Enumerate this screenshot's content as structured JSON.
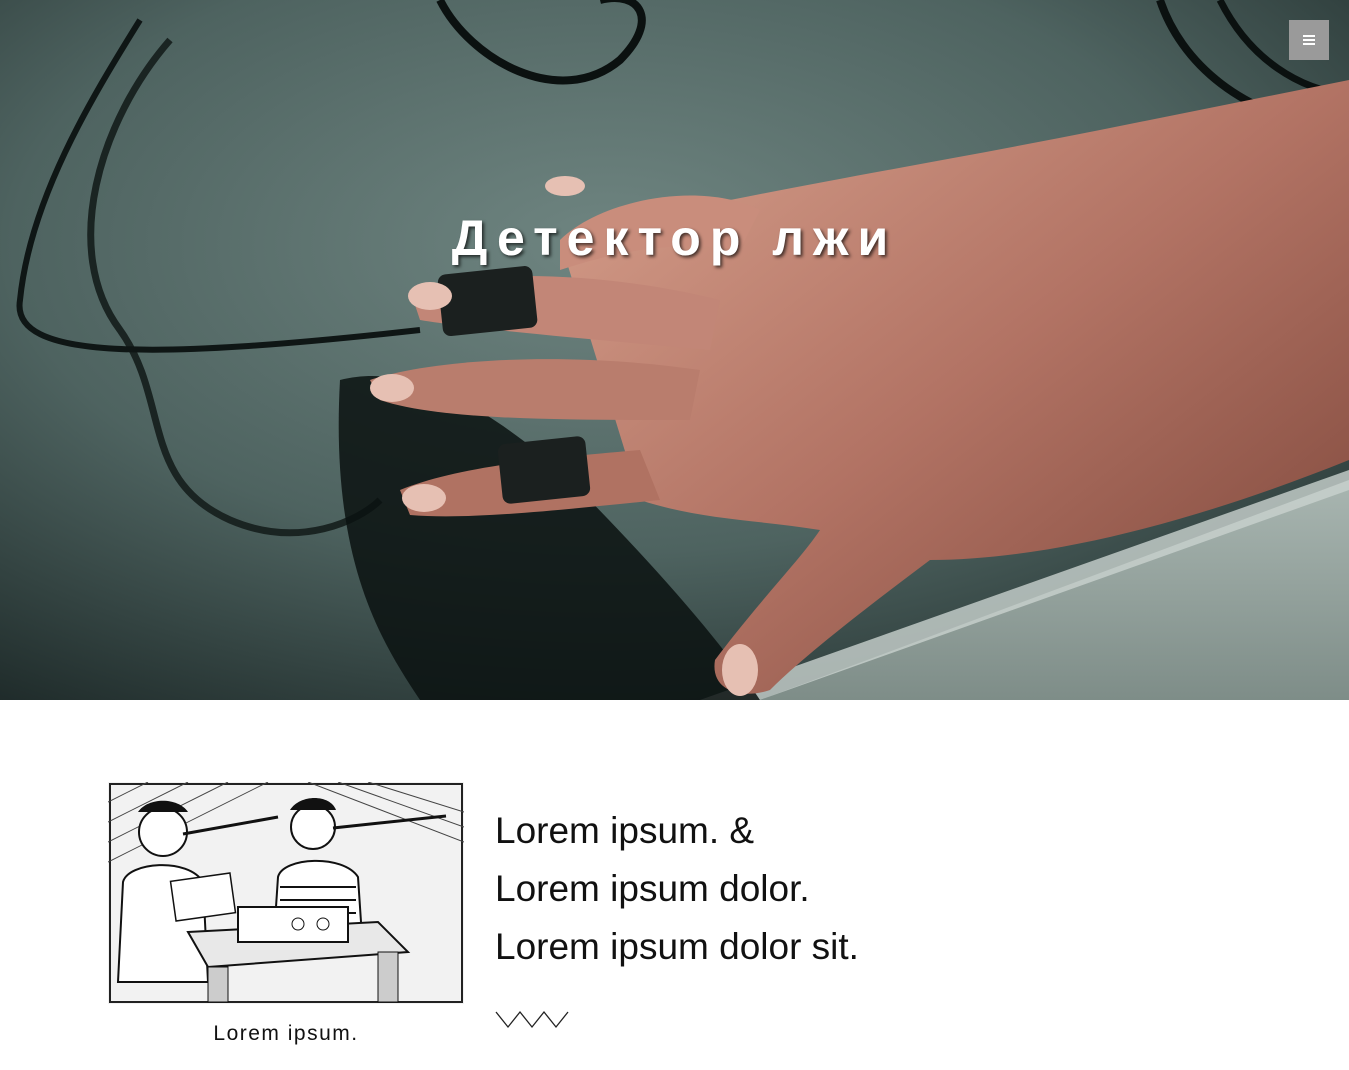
{
  "hero": {
    "title": "Детектор лжи",
    "image": "polygraph-hand-photo",
    "menu_icon": "hamburger-menu-icon"
  },
  "figure": {
    "image": "pinocchio-polygraph-cartoon",
    "caption": "Lorem ipsum."
  },
  "lines": [
    "Lorem ipsum. &",
    "Lorem ipsum dolor.",
    "Lorem ipsum dolor sit."
  ],
  "decor": {
    "divider_icon": "zigzag-icon"
  },
  "colors": {
    "hero_bg": "#4f6461",
    "menu_button": "#9a9a9a",
    "text": "#111111",
    "title": "#ffffff"
  }
}
